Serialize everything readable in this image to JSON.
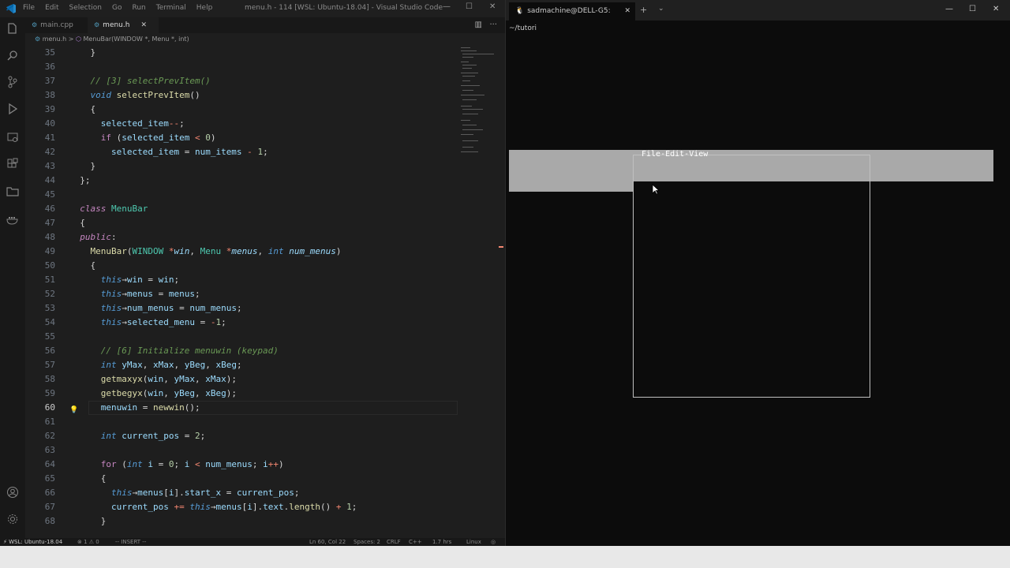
{
  "vscode": {
    "menu": [
      "File",
      "Edit",
      "Selection",
      "Go",
      "Run",
      "Terminal",
      "Help"
    ],
    "window_title": "menu.h - 114 [WSL: Ubuntu-18.04] - Visual Studio Code",
    "tabs": [
      {
        "label": "main.cpp",
        "active": false
      },
      {
        "label": "menu.h",
        "active": true
      }
    ],
    "breadcrumb": {
      "file": "menu.h",
      "separator": ">",
      "symbol": "MenuBar(WINDOW *, Menu *, int)"
    },
    "code": [
      {
        "n": "35",
        "t": [
          [
            "pl",
            "    }"
          ]
        ]
      },
      {
        "n": "36",
        "t": []
      },
      {
        "n": "37",
        "t": [
          [
            "cm",
            "    // [3] selectPrevItem()"
          ]
        ]
      },
      {
        "n": "38",
        "t": [
          [
            "th",
            "    void"
          ],
          [
            "pl",
            " "
          ],
          [
            "fn",
            "selectPrevItem"
          ],
          [
            "pl",
            "()"
          ]
        ]
      },
      {
        "n": "39",
        "t": [
          [
            "pl",
            "    {"
          ]
        ]
      },
      {
        "n": "40",
        "t": [
          [
            "va",
            "      selected_item"
          ],
          [
            "op",
            "--"
          ],
          [
            "pl",
            ";"
          ]
        ]
      },
      {
        "n": "41",
        "t": [
          [
            "kw",
            "      if"
          ],
          [
            "pl",
            " ("
          ],
          [
            "va",
            "selected_item"
          ],
          [
            "op",
            " < "
          ],
          [
            "nu",
            "0"
          ],
          [
            "pl",
            ")"
          ]
        ]
      },
      {
        "n": "42",
        "t": [
          [
            "va",
            "        selected_item"
          ],
          [
            "pl",
            " = "
          ],
          [
            "va",
            "num_items"
          ],
          [
            "op",
            " - "
          ],
          [
            "nu",
            "1"
          ],
          [
            "pl",
            ";"
          ]
        ]
      },
      {
        "n": "43",
        "t": [
          [
            "pl",
            "    }"
          ]
        ]
      },
      {
        "n": "44",
        "t": [
          [
            "pl",
            "  };"
          ]
        ]
      },
      {
        "n": "45",
        "t": []
      },
      {
        "n": "46",
        "t": [
          [
            "kwi",
            "  class"
          ],
          [
            "pl",
            " "
          ],
          [
            "ty",
            "MenuBar"
          ]
        ]
      },
      {
        "n": "47",
        "t": [
          [
            "pl",
            "  {"
          ]
        ]
      },
      {
        "n": "48",
        "t": [
          [
            "kwi",
            "  public"
          ],
          [
            "pl",
            ":"
          ]
        ]
      },
      {
        "n": "49",
        "t": [
          [
            "fn",
            "    MenuBar"
          ],
          [
            "pl",
            "("
          ],
          [
            "ty",
            "WINDOW"
          ],
          [
            "pl",
            " "
          ],
          [
            "op",
            "*"
          ],
          [
            "pa",
            "win"
          ],
          [
            "pl",
            ", "
          ],
          [
            "ty",
            "Menu"
          ],
          [
            "pl",
            " "
          ],
          [
            "op",
            "*"
          ],
          [
            "pa",
            "menus"
          ],
          [
            "pl",
            ", "
          ],
          [
            "th",
            "int"
          ],
          [
            "pl",
            " "
          ],
          [
            "pa",
            "num_menus"
          ],
          [
            "pl",
            ")"
          ]
        ]
      },
      {
        "n": "50",
        "t": [
          [
            "pl",
            "    {"
          ]
        ]
      },
      {
        "n": "51",
        "t": [
          [
            "th",
            "      this"
          ],
          [
            "pl",
            "→"
          ],
          [
            "va",
            "win"
          ],
          [
            "pl",
            " = "
          ],
          [
            "va",
            "win"
          ],
          [
            "pl",
            ";"
          ]
        ]
      },
      {
        "n": "52",
        "t": [
          [
            "th",
            "      this"
          ],
          [
            "pl",
            "→"
          ],
          [
            "va",
            "menus"
          ],
          [
            "pl",
            " = "
          ],
          [
            "va",
            "menus"
          ],
          [
            "pl",
            ";"
          ]
        ]
      },
      {
        "n": "53",
        "t": [
          [
            "th",
            "      this"
          ],
          [
            "pl",
            "→"
          ],
          [
            "va",
            "num_menus"
          ],
          [
            "pl",
            " = "
          ],
          [
            "va",
            "num_menus"
          ],
          [
            "pl",
            ";"
          ]
        ]
      },
      {
        "n": "54",
        "t": [
          [
            "th",
            "      this"
          ],
          [
            "pl",
            "→"
          ],
          [
            "va",
            "selected_menu"
          ],
          [
            "pl",
            " = "
          ],
          [
            "op",
            "-"
          ],
          [
            "nu",
            "1"
          ],
          [
            "pl",
            ";"
          ]
        ]
      },
      {
        "n": "55",
        "t": []
      },
      {
        "n": "56",
        "t": [
          [
            "cm",
            "      // [6] Initialize menuwin (keypad)"
          ]
        ]
      },
      {
        "n": "57",
        "t": [
          [
            "th",
            "      int"
          ],
          [
            "pl",
            " "
          ],
          [
            "va",
            "yMax"
          ],
          [
            "pl",
            ", "
          ],
          [
            "va",
            "xMax"
          ],
          [
            "pl",
            ", "
          ],
          [
            "va",
            "yBeg"
          ],
          [
            "pl",
            ", "
          ],
          [
            "va",
            "xBeg"
          ],
          [
            "pl",
            ";"
          ]
        ]
      },
      {
        "n": "58",
        "t": [
          [
            "fn",
            "      getmaxyx"
          ],
          [
            "pl",
            "("
          ],
          [
            "va",
            "win"
          ],
          [
            "pl",
            ", "
          ],
          [
            "va",
            "yMax"
          ],
          [
            "pl",
            ", "
          ],
          [
            "va",
            "xMax"
          ],
          [
            "pl",
            ");"
          ]
        ]
      },
      {
        "n": "59",
        "t": [
          [
            "fn",
            "      getbegyx"
          ],
          [
            "pl",
            "("
          ],
          [
            "va",
            "win"
          ],
          [
            "pl",
            ", "
          ],
          [
            "va",
            "yBeg"
          ],
          [
            "pl",
            ", "
          ],
          [
            "va",
            "xBeg"
          ],
          [
            "pl",
            ");"
          ]
        ]
      },
      {
        "n": "60",
        "t": [
          [
            "va",
            "      menuwin"
          ],
          [
            "pl",
            " = "
          ],
          [
            "fn",
            "newwin"
          ],
          [
            "pl",
            "();"
          ]
        ],
        "current": true
      },
      {
        "n": "61",
        "t": []
      },
      {
        "n": "62",
        "t": [
          [
            "th",
            "      int"
          ],
          [
            "pl",
            " "
          ],
          [
            "va",
            "current_pos"
          ],
          [
            "pl",
            " = "
          ],
          [
            "nu",
            "2"
          ],
          [
            "pl",
            ";"
          ]
        ]
      },
      {
        "n": "63",
        "t": []
      },
      {
        "n": "64",
        "t": [
          [
            "kw",
            "      for"
          ],
          [
            "pl",
            " ("
          ],
          [
            "th",
            "int"
          ],
          [
            "pl",
            " "
          ],
          [
            "va",
            "i"
          ],
          [
            "pl",
            " = "
          ],
          [
            "nu",
            "0"
          ],
          [
            "pl",
            "; "
          ],
          [
            "va",
            "i"
          ],
          [
            "op",
            " < "
          ],
          [
            "va",
            "num_menus"
          ],
          [
            "pl",
            "; "
          ],
          [
            "va",
            "i"
          ],
          [
            "op",
            "++"
          ],
          [
            "pl",
            ")"
          ]
        ]
      },
      {
        "n": "65",
        "t": [
          [
            "pl",
            "      {"
          ]
        ]
      },
      {
        "n": "66",
        "t": [
          [
            "th",
            "        this"
          ],
          [
            "pl",
            "→"
          ],
          [
            "va",
            "menus"
          ],
          [
            "pl",
            "["
          ],
          [
            "va",
            "i"
          ],
          [
            "pl",
            "]."
          ],
          [
            "va",
            "start_x"
          ],
          [
            "pl",
            " = "
          ],
          [
            "va",
            "current_pos"
          ],
          [
            "pl",
            ";"
          ]
        ]
      },
      {
        "n": "67",
        "t": [
          [
            "va",
            "        current_pos"
          ],
          [
            "op",
            " += "
          ],
          [
            "th",
            "this"
          ],
          [
            "pl",
            "→"
          ],
          [
            "va",
            "menus"
          ],
          [
            "pl",
            "["
          ],
          [
            "va",
            "i"
          ],
          [
            "pl",
            "]."
          ],
          [
            "va",
            "text"
          ],
          [
            "pl",
            "."
          ],
          [
            "fn",
            "length"
          ],
          [
            "pl",
            "()"
          ],
          [
            "op",
            " + "
          ],
          [
            "nu",
            "1"
          ],
          [
            "pl",
            ";"
          ]
        ]
      },
      {
        "n": "68",
        "t": [
          [
            "pl",
            "      }"
          ]
        ]
      }
    ],
    "status": {
      "remote": "WSL: Ubuntu-18.04",
      "problems": "⊗ 1 ⚠ 0",
      "mode": "-- INSERT --",
      "position": "Ln 60, Col 22",
      "spaces": "Spaces: 2",
      "eol": "CRLF",
      "language": "C++",
      "time": "1.7 hrs",
      "os": "Linux"
    },
    "colors": {
      "accent": "#007acc",
      "remote_bg": "#16825d"
    }
  },
  "terminal": {
    "tab_title": "sadmachine@DELL-G5: ~/tutori",
    "window_title_text": "File Edit View",
    "window_title": "File-Edit-View"
  }
}
